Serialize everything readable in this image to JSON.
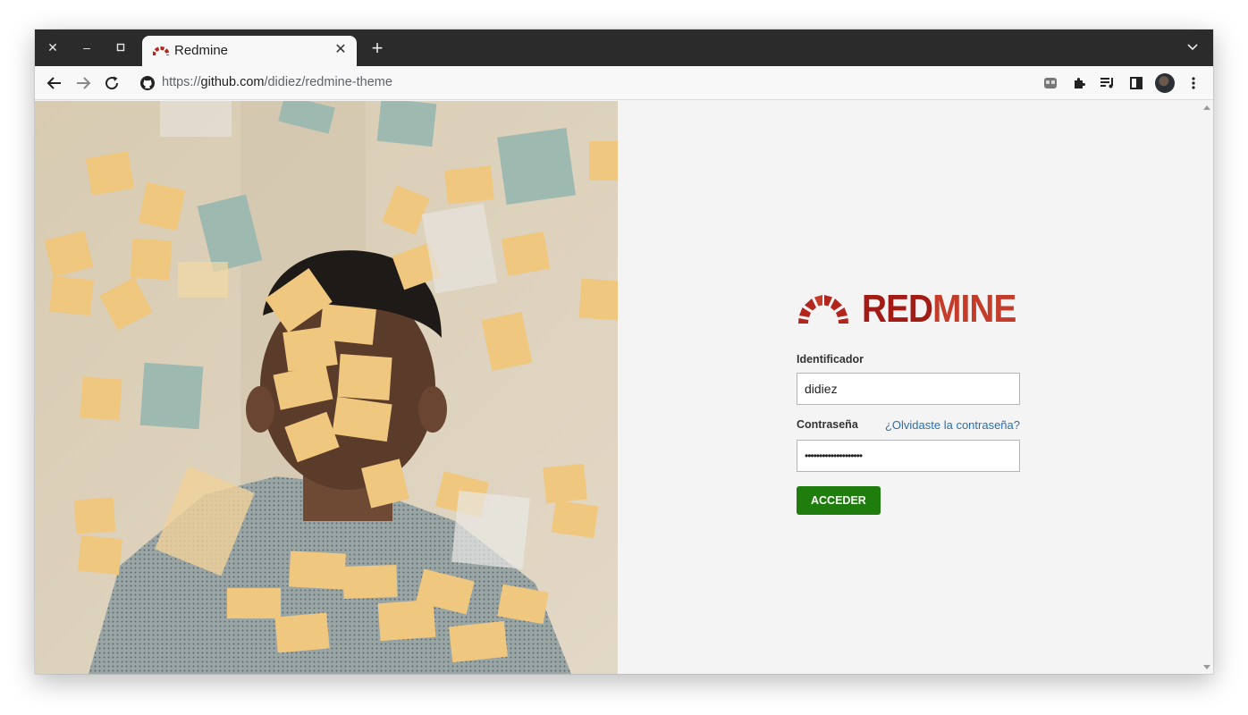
{
  "browser": {
    "tab_title": "Redmine",
    "url_scheme": "https://",
    "url_host": "github.com",
    "url_path": "/didiez/redmine-theme",
    "window_buttons": [
      "close",
      "minimize",
      "maximize"
    ]
  },
  "login": {
    "logo_red": "RED",
    "logo_rest": "MINE",
    "username_label": "Identificador",
    "username_value": "didiez",
    "password_label": "Contraseña",
    "forgot_link": "¿Olvidaste la contraseña?",
    "password_mask": "••••••••••••••••••••",
    "submit_label": "ACCEDER"
  },
  "colors": {
    "brand_red": "#a31b15",
    "brand_red_light": "#c43d2b",
    "submit_green": "#1e7d0c",
    "link_blue": "#2a6eb0"
  },
  "icons": [
    "close-icon",
    "minimize-icon",
    "maximize-icon",
    "redmine-favicon",
    "tab-close-icon",
    "new-tab-icon",
    "tab-search-icon",
    "back-icon",
    "forward-icon",
    "reload-icon",
    "github-icon",
    "media-icon",
    "extensions-icon",
    "reading-list-icon",
    "side-panel-icon",
    "avatar",
    "menu-icon"
  ]
}
